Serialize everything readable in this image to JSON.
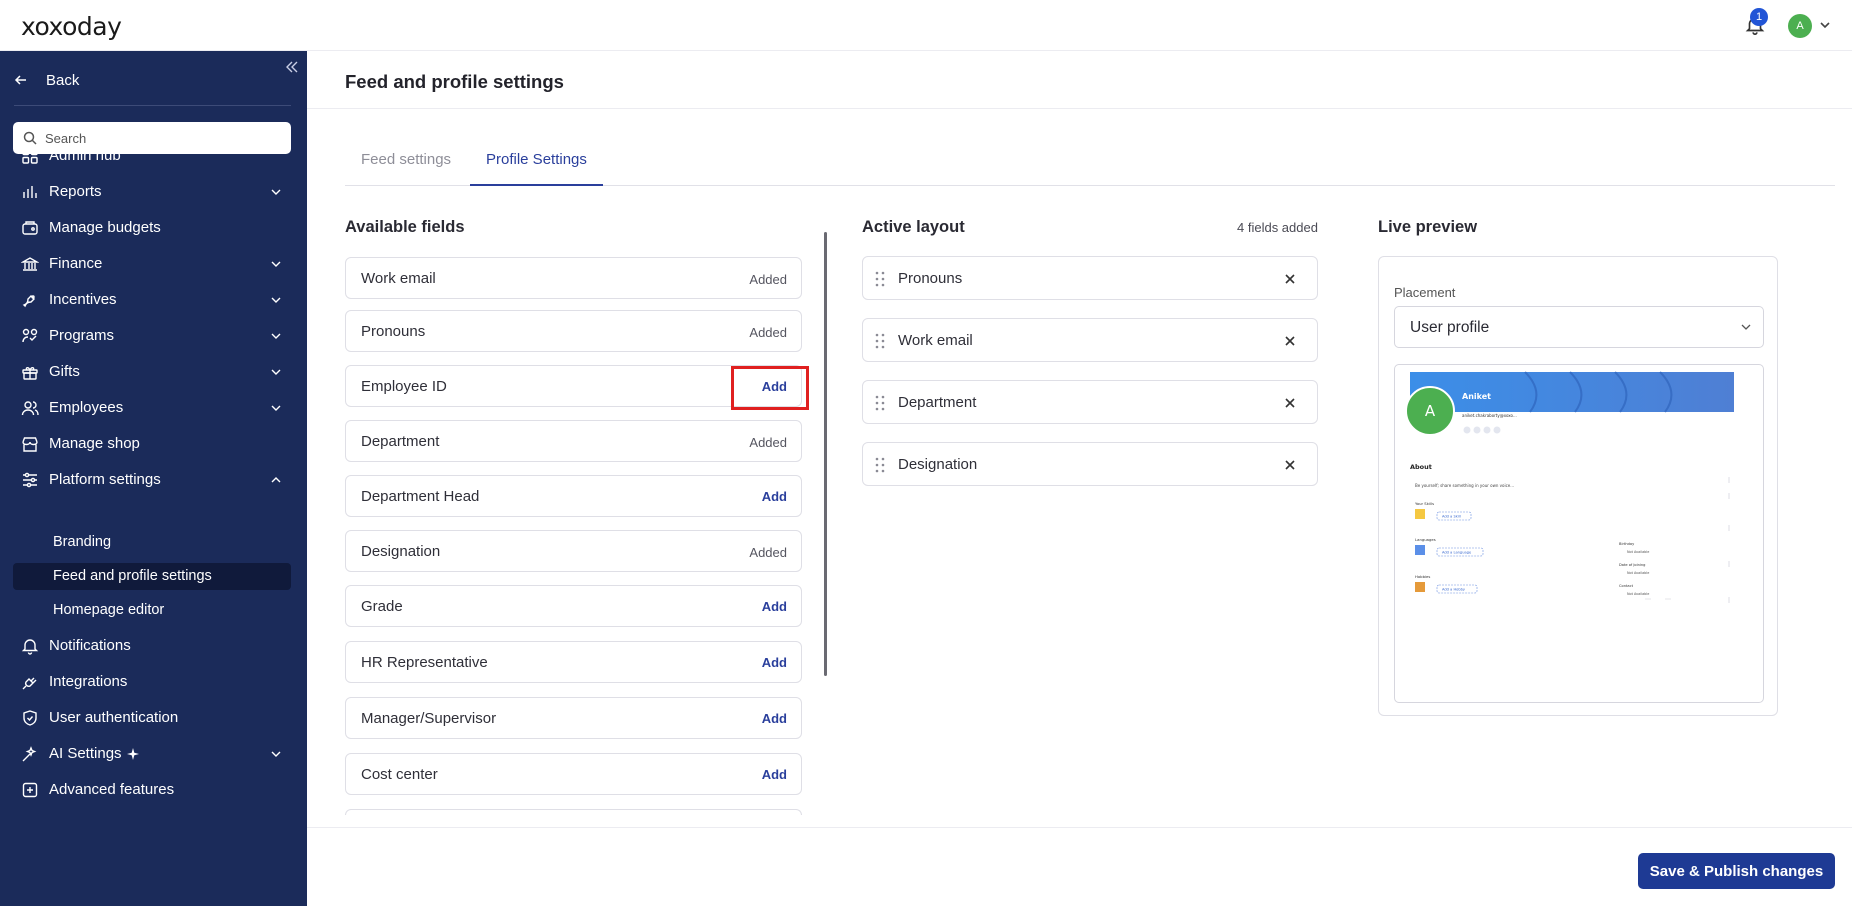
{
  "topbar": {
    "logo": "xoxoday",
    "notification_count": "1",
    "avatar_initial": "A"
  },
  "sidebar": {
    "back_label": "Back",
    "search_placeholder": "Search",
    "items": [
      {
        "label": "Admin hub",
        "icon": "grid-icon",
        "has_chevron": false
      },
      {
        "label": "Reports",
        "icon": "bar-chart-icon",
        "has_chevron": true
      },
      {
        "label": "Manage budgets",
        "icon": "budget-icon",
        "has_chevron": false
      },
      {
        "label": "Finance",
        "icon": "bank-icon",
        "has_chevron": true
      },
      {
        "label": "Incentives",
        "icon": "incentive-icon",
        "has_chevron": true
      },
      {
        "label": "Programs",
        "icon": "programs-icon",
        "has_chevron": true
      },
      {
        "label": "Gifts",
        "icon": "gift-icon",
        "has_chevron": true
      },
      {
        "label": "Employees",
        "icon": "users-icon",
        "has_chevron": true
      },
      {
        "label": "Manage shop",
        "icon": "shop-icon",
        "has_chevron": false
      },
      {
        "label": "Platform settings",
        "icon": "sliders-icon",
        "has_chevron": true,
        "expanded": true
      },
      {
        "label": "Notifications",
        "icon": "bell-icon",
        "has_chevron": false
      },
      {
        "label": "Integrations",
        "icon": "plug-icon",
        "has_chevron": false
      },
      {
        "label": "User authentication",
        "icon": "shield-check-icon",
        "has_chevron": false
      },
      {
        "label": "AI Settings",
        "icon": "sparkle-icon",
        "has_chevron": true
      },
      {
        "label": "Advanced features",
        "icon": "plus-box-icon",
        "has_chevron": false
      }
    ],
    "sub_items": [
      {
        "label": "Branding",
        "active": false
      },
      {
        "label": "Feed and profile settings",
        "active": true
      },
      {
        "label": "Homepage editor",
        "active": false
      }
    ]
  },
  "page": {
    "title": "Feed and profile settings",
    "tabs": [
      {
        "label": "Feed settings",
        "active": false
      },
      {
        "label": "Profile Settings",
        "active": true
      }
    ]
  },
  "available": {
    "title": "Available fields",
    "added_label": "Added",
    "add_label": "Add",
    "fields": [
      {
        "name": "Work email",
        "status": "added"
      },
      {
        "name": "Pronouns",
        "status": "added"
      },
      {
        "name": "Employee ID",
        "status": "add"
      },
      {
        "name": "Department",
        "status": "added"
      },
      {
        "name": "Department Head",
        "status": "add"
      },
      {
        "name": "Designation",
        "status": "added"
      },
      {
        "name": "Grade",
        "status": "add"
      },
      {
        "name": "HR Representative",
        "status": "add"
      },
      {
        "name": "Manager/Supervisor",
        "status": "add"
      },
      {
        "name": "Cost center",
        "status": "add"
      }
    ]
  },
  "active_layout": {
    "title": "Active layout",
    "count_text": "4 fields added",
    "fields": [
      "Pronouns",
      "Work email",
      "Department",
      "Designation"
    ]
  },
  "preview": {
    "title": "Live preview",
    "placement_label": "Placement",
    "placement_value": "User profile",
    "profile": {
      "initial": "A",
      "name": "Aniket",
      "email": "aniket.chakraborty@xoxo...",
      "about_title": "About",
      "about_text": "Be yourself; share something in your own voice...",
      "skills_label": "Your Skills",
      "add_skill": "Add a Skill",
      "languages_label": "Languages",
      "add_language": "Add a Language",
      "hobbies_label": "Hobbies",
      "add_hobby": "Add a Hobby",
      "birthday_label": "Birthday",
      "joining_label": "Date of Joining",
      "contact_label": "Contact",
      "not_available": "Not Available"
    }
  },
  "footer": {
    "save_label": "Save & Publish changes"
  },
  "colors": {
    "sidebar_bg": "#1b2b5a",
    "accent": "#2a3f9c",
    "save_bg": "#1e3a94",
    "highlight": "#e02020",
    "avatar": "#4caf50"
  }
}
